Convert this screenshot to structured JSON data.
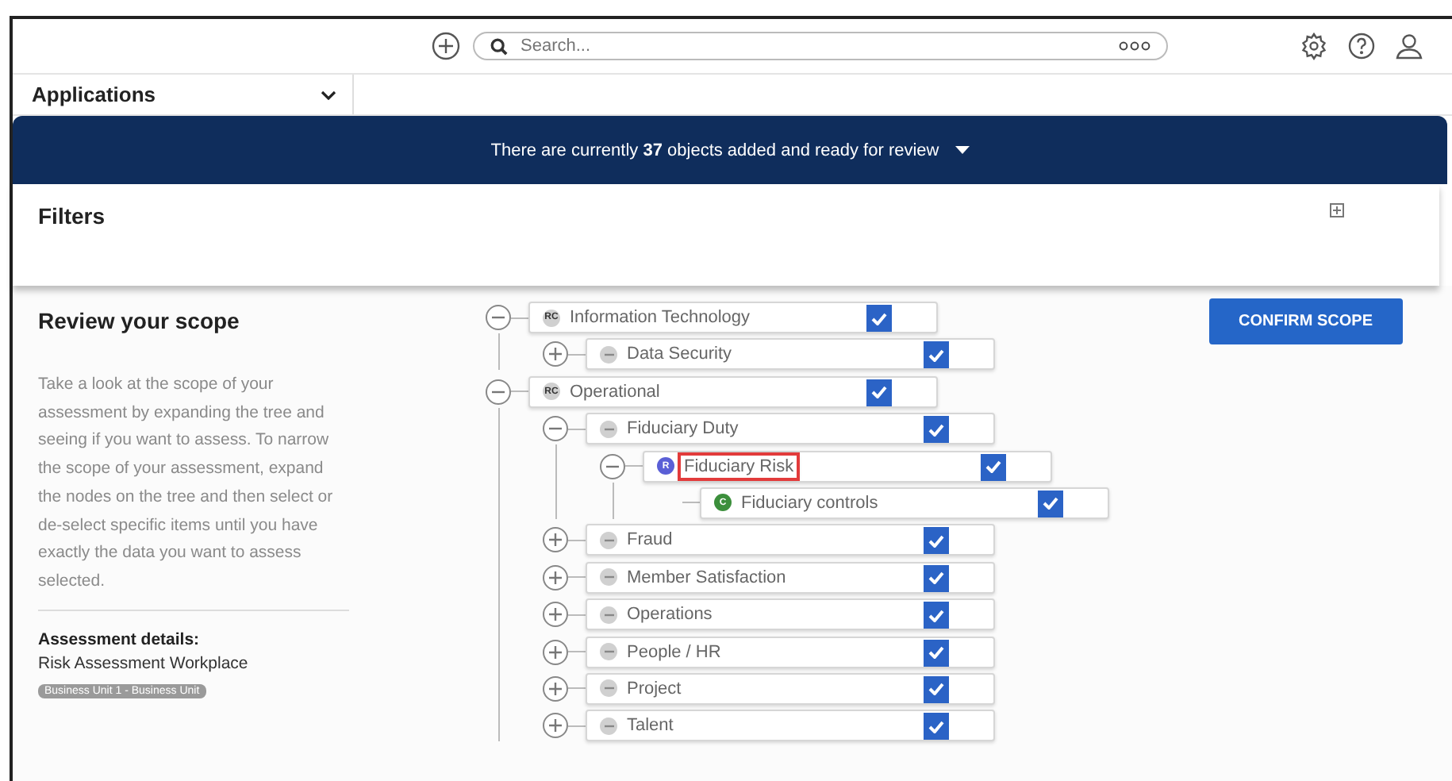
{
  "header": {
    "search": {
      "placeholder": "Search..."
    }
  },
  "applications": {
    "label": "Applications"
  },
  "banner": {
    "text": "There are currently **37** objects added and ready for review"
  },
  "filters": {
    "title": "Filters"
  },
  "scope": {
    "title": "Review your scope",
    "description": "Take a look at the scope of your assessment by expanding the tree and seeing if you want to assess. To narrow the scope of your assessment, expand the nodes on the tree and then select or de-select specific items until you have exactly the data you want to assess selected.",
    "details_label": "Assessment details:",
    "details_value": "Risk Assessment Workplace",
    "tag": "Business Unit 1 - Business Unit"
  },
  "confirm_button": "CONFIRM SCOPE",
  "tree": [
    {
      "label": "Information Technology",
      "badge": "RC",
      "color": "#d0d0d0",
      "expanded": true,
      "checked": true,
      "highlighted": false,
      "children": [
        {
          "label": "Data Security",
          "color": "#d0d0d0",
          "expanded": false,
          "checked": true,
          "highlighted": false
        }
      ]
    },
    {
      "label": "Operational",
      "badge": "RC",
      "color": "#d0d0d0",
      "expanded": true,
      "checked": true,
      "highlighted": false,
      "children": [
        {
          "label": "Fiduciary Duty",
          "color": "#d0d0d0",
          "expanded": true,
          "checked": true,
          "highlighted": false,
          "children": [
            {
              "label": "Fiduciary Risk",
              "badge": "R",
              "color": "#5a5fd6",
              "expanded": true,
              "checked": true,
              "highlighted": true,
              "children": [
                {
                  "label": "Fiduciary controls",
                  "badge": "C",
                  "color": "#3c8f3c",
                  "checked": true,
                  "highlighted": false
                }
              ]
            }
          ]
        },
        {
          "label": "Fraud",
          "color": "#d0d0d0",
          "expanded": false,
          "checked": true,
          "highlighted": false
        },
        {
          "label": "Member Satisfaction",
          "color": "#d0d0d0",
          "expanded": false,
          "checked": true,
          "highlighted": false
        },
        {
          "label": "Operations",
          "color": "#d0d0d0",
          "expanded": false,
          "checked": true,
          "highlighted": false
        },
        {
          "label": "People / HR",
          "color": "#d0d0d0",
          "expanded": false,
          "checked": true,
          "highlighted": false
        },
        {
          "label": "Project",
          "color": "#d0d0d0",
          "expanded": false,
          "checked": true,
          "highlighted": false
        },
        {
          "label": "Talent",
          "color": "#d0d0d0",
          "expanded": false,
          "checked": true,
          "highlighted": false
        }
      ]
    }
  ]
}
